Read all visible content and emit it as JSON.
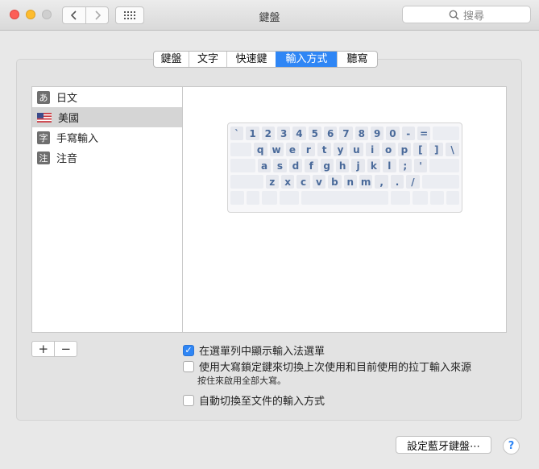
{
  "window": {
    "title": "鍵盤"
  },
  "search": {
    "placeholder": "搜尋"
  },
  "tabs": [
    {
      "label": "鍵盤"
    },
    {
      "label": "文字"
    },
    {
      "label": "快速鍵"
    },
    {
      "label": "輸入方式",
      "active": true
    },
    {
      "label": "聽寫"
    }
  ],
  "input_sources": [
    {
      "icon_text": "あ",
      "icon": "hiragana-icon",
      "label": "日文"
    },
    {
      "icon_text": "",
      "icon": "us-flag-icon",
      "label": "美國",
      "selected": true
    },
    {
      "icon_text": "字",
      "icon": "handwriting-icon",
      "label": "手寫輸入"
    },
    {
      "icon_text": "注",
      "icon": "zhuyin-icon",
      "label": "注音"
    }
  ],
  "keyboard": {
    "row1": [
      "`",
      "1",
      "2",
      "3",
      "4",
      "5",
      "6",
      "7",
      "8",
      "9",
      "0",
      "-",
      "="
    ],
    "row2": [
      "q",
      "w",
      "e",
      "r",
      "t",
      "y",
      "u",
      "i",
      "o",
      "p",
      "[",
      "]",
      "\\"
    ],
    "row3": [
      "a",
      "s",
      "d",
      "f",
      "g",
      "h",
      "j",
      "k",
      "l",
      ";",
      "'"
    ],
    "row4": [
      "z",
      "x",
      "c",
      "v",
      "b",
      "n",
      "m",
      ",",
      ".",
      "/"
    ]
  },
  "controls": {
    "add": "+",
    "remove": "−"
  },
  "options": {
    "show_menu": {
      "label": "在選單列中顯示輸入法選單",
      "checked": true
    },
    "caps_lock": {
      "label": "使用大寫鎖定鍵來切換上次使用和目前使用的拉丁輸入來源",
      "checked": false
    },
    "caps_hint": "按住來啟用全部大寫。",
    "auto_switch": {
      "label": "自動切換至文件的輸入方式",
      "checked": false
    }
  },
  "bluetooth_button": "設定藍牙鍵盤⋯",
  "help": "?"
}
